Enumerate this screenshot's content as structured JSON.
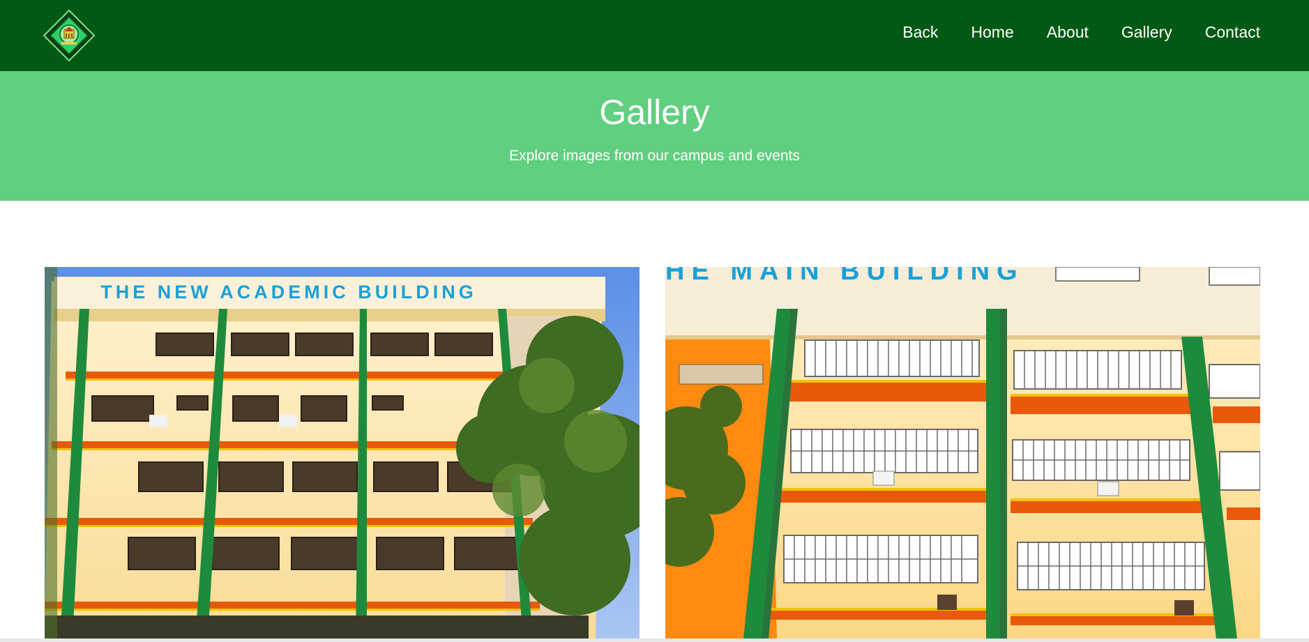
{
  "header": {
    "logo_alt": "school seal logo",
    "nav": [
      "Back",
      "Home",
      "About",
      "Gallery",
      "Contact"
    ]
  },
  "hero": {
    "title": "Gallery",
    "subtitle": "Explore images from our campus and events"
  },
  "gallery": [
    {
      "sign": "THE NEW ACADEMIC BUILDING"
    },
    {
      "sign": "HE MAIN BUILDING"
    }
  ],
  "colors": {
    "header_bg": "#025914",
    "hero_bg": "#60cf7f",
    "building_wall": "#fbe8b0",
    "pillar_green": "#1e8a3c",
    "ledge_orange": "#e8590c",
    "sign_blue": "#1aa0d8"
  }
}
